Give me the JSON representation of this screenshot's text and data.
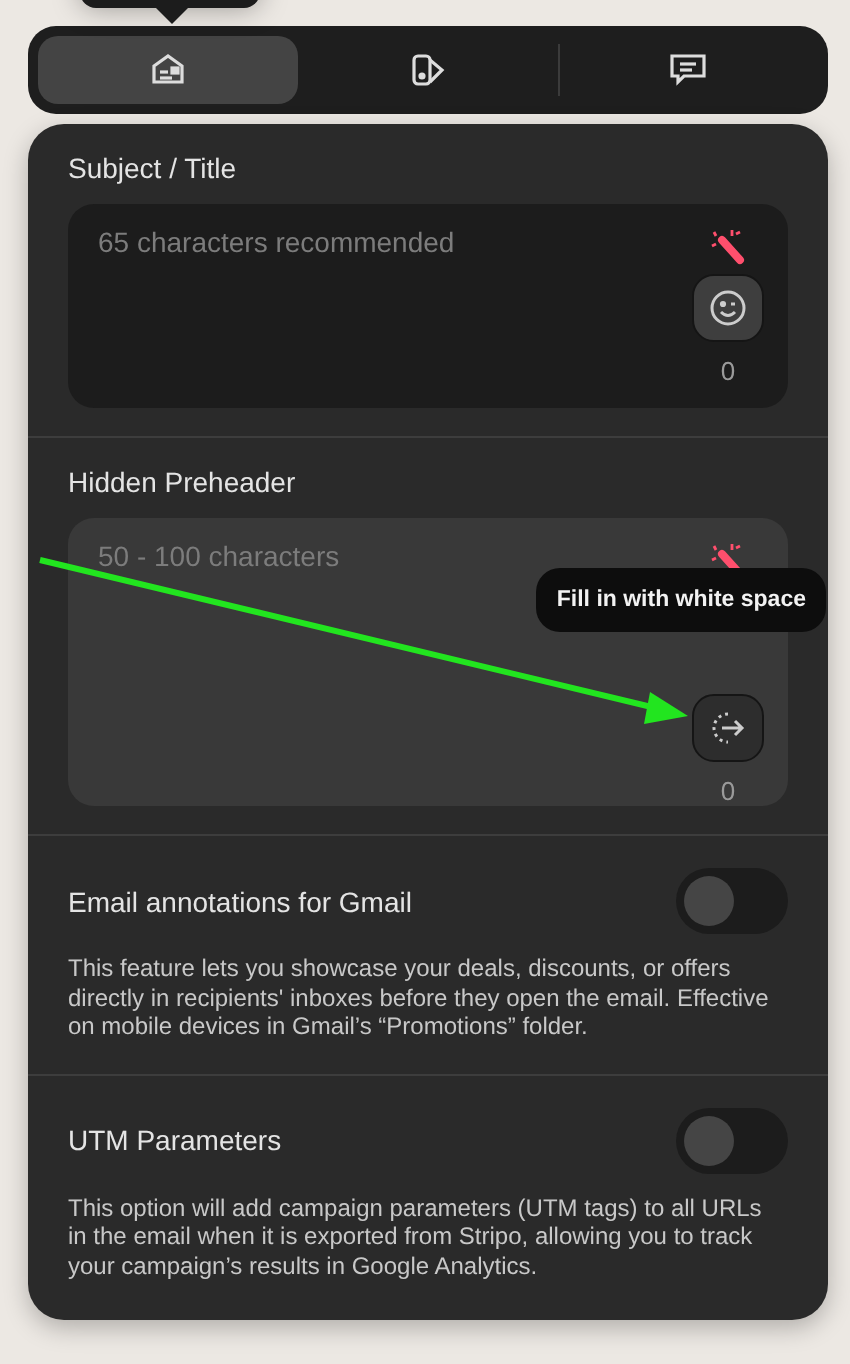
{
  "tabs": [
    {
      "kind": "details",
      "selected": true
    },
    {
      "kind": "style",
      "selected": false
    },
    {
      "kind": "comments",
      "selected": false
    }
  ],
  "fields": [
    {
      "label": "Subject / Title",
      "placeholder": "65 characters recommended",
      "count": "0",
      "hovered": false,
      "kind": "emoji"
    },
    {
      "label": "Hidden Preheader",
      "placeholder": "50 - 100 characters",
      "count": "0",
      "hovered": true,
      "kind": "whitespace",
      "tooltip": "Fill in with white space"
    }
  ],
  "toggles": [
    {
      "label": "Email annotations for Gmail",
      "on": false,
      "description": "This feature lets you showcase your deals, discounts, or offers directly in recipients' inboxes before they open the email. Effective on mobile devices in Gmail’s “Promotions” folder."
    },
    {
      "label": "UTM Parameters",
      "on": false,
      "description": "This option will add campaign parameters (UTM tags) to all URLs in the email when it is exported from Stripo, allowing you to track your campaign’s results in Google Analytics."
    }
  ]
}
